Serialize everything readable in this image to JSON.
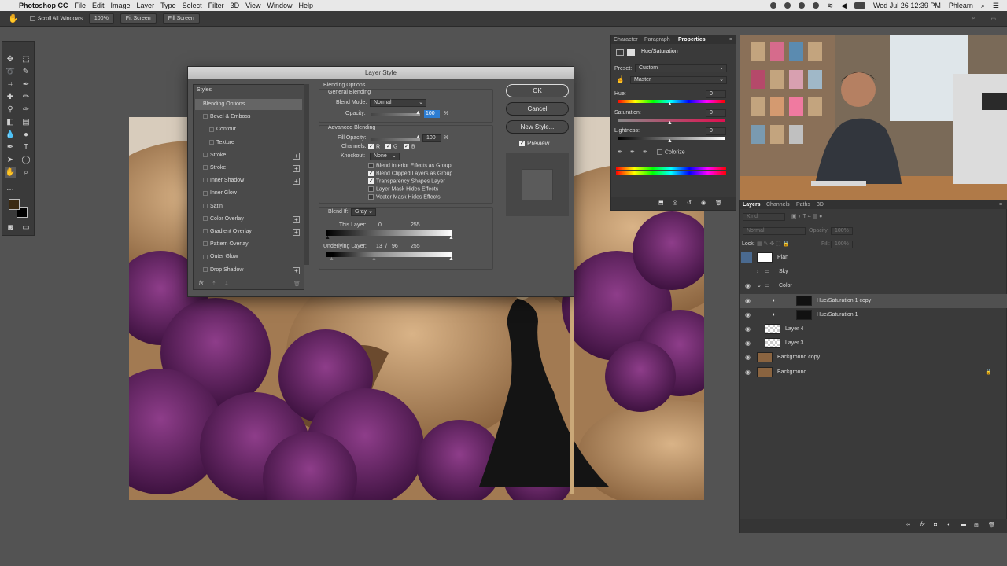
{
  "menubar": {
    "app": "Photoshop CC",
    "items": [
      "File",
      "Edit",
      "Image",
      "Layer",
      "Type",
      "Select",
      "Filter",
      "3D",
      "View",
      "Window",
      "Help"
    ],
    "datetime": "Wed Jul 26  12:39 PM",
    "user": "Phlearn"
  },
  "options": {
    "scroll_all": "Scroll All Windows",
    "zoom": "100%",
    "fit": "Fit Screen",
    "fill": "Fill Screen"
  },
  "dialog": {
    "title": "Layer Style",
    "styles_header": "Styles",
    "styles": [
      {
        "label": "Blending Options",
        "selected": true,
        "checkbox": false,
        "plus": false,
        "indent": false
      },
      {
        "label": "Bevel & Emboss",
        "checkbox": true,
        "plus": false,
        "indent": false
      },
      {
        "label": "Contour",
        "checkbox": true,
        "plus": false,
        "indent": true
      },
      {
        "label": "Texture",
        "checkbox": true,
        "plus": false,
        "indent": true
      },
      {
        "label": "Stroke",
        "checkbox": true,
        "plus": true,
        "indent": false
      },
      {
        "label": "Stroke",
        "checkbox": true,
        "plus": true,
        "indent": false
      },
      {
        "label": "Inner Shadow",
        "checkbox": true,
        "plus": true,
        "indent": false
      },
      {
        "label": "Inner Glow",
        "checkbox": true,
        "plus": false,
        "indent": false
      },
      {
        "label": "Satin",
        "checkbox": true,
        "plus": false,
        "indent": false
      },
      {
        "label": "Color Overlay",
        "checkbox": true,
        "plus": true,
        "indent": false
      },
      {
        "label": "Gradient Overlay",
        "checkbox": true,
        "plus": true,
        "indent": false
      },
      {
        "label": "Pattern Overlay",
        "checkbox": true,
        "plus": false,
        "indent": false
      },
      {
        "label": "Outer Glow",
        "checkbox": true,
        "plus": false,
        "indent": false
      },
      {
        "label": "Drop Shadow",
        "checkbox": true,
        "plus": true,
        "indent": false
      }
    ],
    "fx_label": "fx",
    "blending_options": "Blending Options",
    "general_blending": "General Blending",
    "blend_mode_label": "Blend Mode:",
    "blend_mode": "Normal",
    "opacity_label": "Opacity:",
    "opacity": "100",
    "pct": "%",
    "advanced_blending": "Advanced Blending",
    "fill_opacity_label": "Fill Opacity:",
    "fill_opacity": "100",
    "channels_label": "Channels:",
    "channels": [
      "R",
      "G",
      "B"
    ],
    "knockout_label": "Knockout:",
    "knockout": "None",
    "adv_options": [
      {
        "label": "Blend Interior Effects as Group",
        "checked": false
      },
      {
        "label": "Blend Clipped Layers as Group",
        "checked": true
      },
      {
        "label": "Transparency Shapes Layer",
        "checked": true
      },
      {
        "label": "Layer Mask Hides Effects",
        "checked": false
      },
      {
        "label": "Vector Mask Hides Effects",
        "checked": false
      }
    ],
    "blend_if_label": "Blend If:",
    "blend_if": "Gray",
    "this_layer_label": "This Layer:",
    "this_layer_min": "0",
    "this_layer_max": "255",
    "underlying_label": "Underlying Layer:",
    "underlying_a": "13",
    "underlying_sep": "/",
    "underlying_b": "96",
    "underlying_max": "255",
    "ok": "OK",
    "cancel": "Cancel",
    "new_style": "New Style...",
    "preview": "Preview"
  },
  "properties": {
    "tabs": [
      "Character",
      "Paragraph",
      "Properties"
    ],
    "active_tab": "Properties",
    "title": "Hue/Saturation",
    "preset_label": "Preset:",
    "preset": "Custom",
    "channel": "Master",
    "hue_label": "Hue:",
    "hue": "0",
    "sat_label": "Saturation:",
    "sat": "0",
    "light_label": "Lightness:",
    "light": "0",
    "colorize": "Colorize"
  },
  "layers": {
    "tabs": [
      "Layers",
      "Channels",
      "Paths",
      "3D"
    ],
    "kind": "Kind",
    "blend": "Normal",
    "opacity_label": "Opacity:",
    "opacity": "100%",
    "lock_label": "Lock:",
    "fill_label": "Fill:",
    "fill": "100%",
    "items": [
      {
        "name": "Plan",
        "eye": false,
        "indent": 0,
        "type": "pixel"
      },
      {
        "name": "Sky",
        "eye": false,
        "indent": 0,
        "type": "folder"
      },
      {
        "name": "Color",
        "eye": true,
        "indent": 0,
        "type": "folder"
      },
      {
        "name": "Hue/Saturation 1 copy",
        "eye": true,
        "indent": 1,
        "type": "adjust",
        "selected": true
      },
      {
        "name": "Hue/Saturation 1",
        "eye": true,
        "indent": 1,
        "type": "adjust"
      },
      {
        "name": "Layer 4",
        "eye": true,
        "indent": 1,
        "type": "pixel"
      },
      {
        "name": "Layer 3",
        "eye": true,
        "indent": 1,
        "type": "pixel"
      },
      {
        "name": "Background copy",
        "eye": true,
        "indent": 0,
        "type": "photo"
      },
      {
        "name": "Background",
        "eye": true,
        "indent": 0,
        "type": "photo",
        "locked": true
      }
    ]
  },
  "colors": {
    "accent": "#2d7dd2",
    "fg_swatch": "#3b2a12",
    "bg_swatch": "#000000"
  }
}
